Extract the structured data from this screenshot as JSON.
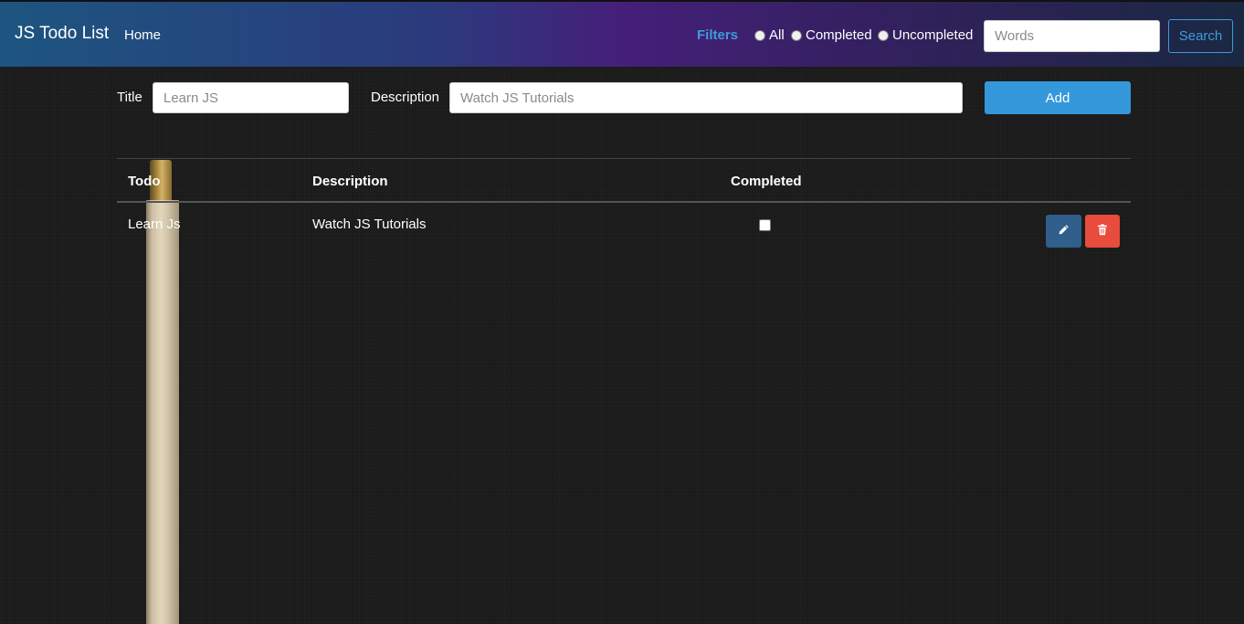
{
  "navbar": {
    "brand": "JS Todo List",
    "home": "Home",
    "filters_label": "Filters",
    "filters": [
      {
        "label": "All"
      },
      {
        "label": "Completed"
      },
      {
        "label": "Uncompleted"
      }
    ],
    "search_placeholder": "Words",
    "search_button": "Search"
  },
  "form": {
    "title_label": "Title",
    "title_placeholder": "Learn JS",
    "description_label": "Description",
    "description_placeholder": "Watch JS Tutorials",
    "add_button": "Add"
  },
  "table": {
    "headers": [
      "Todo",
      "Description",
      "Completed"
    ],
    "rows": [
      {
        "todo": "Learn Js",
        "description": "Watch JS Tutorials",
        "completed": false
      }
    ]
  },
  "colors": {
    "accent": "#3498db",
    "filters": "#3e9bd9",
    "edit": "#2f5f8a",
    "delete": "#e74c3c"
  },
  "icons": [
    "pencil-icon",
    "trash-icon"
  ]
}
